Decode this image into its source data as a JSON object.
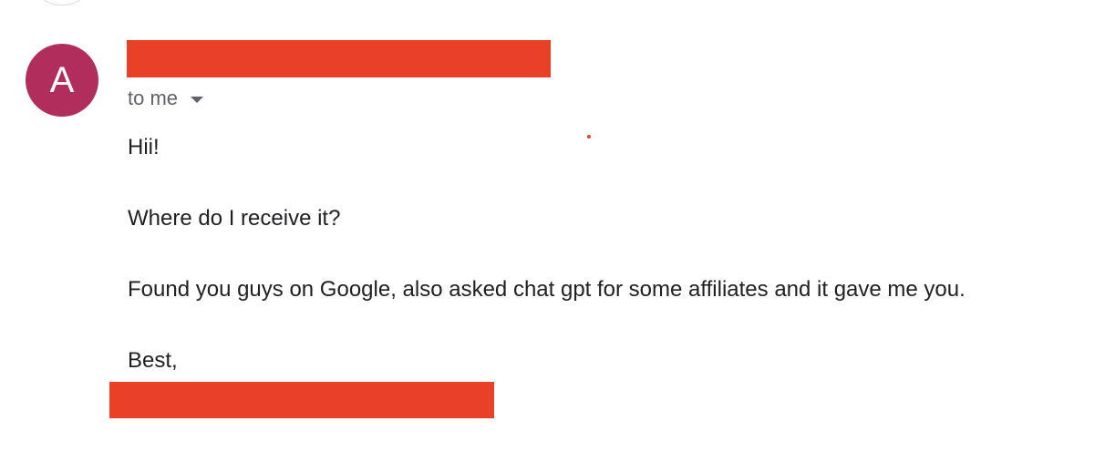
{
  "colors": {
    "avatar_bg": "#b12d5b",
    "redaction": "#e84127"
  },
  "sender": {
    "avatar_letter": "A",
    "recipients_label": "to me",
    "recipients_toggle_icon": "caret-down-icon"
  },
  "message": {
    "lines": [
      "Hii!",
      "Where do I receive it?",
      "Found you guys on Google, also asked chat gpt for some affiliates and it gave me you.",
      "Best,"
    ]
  }
}
